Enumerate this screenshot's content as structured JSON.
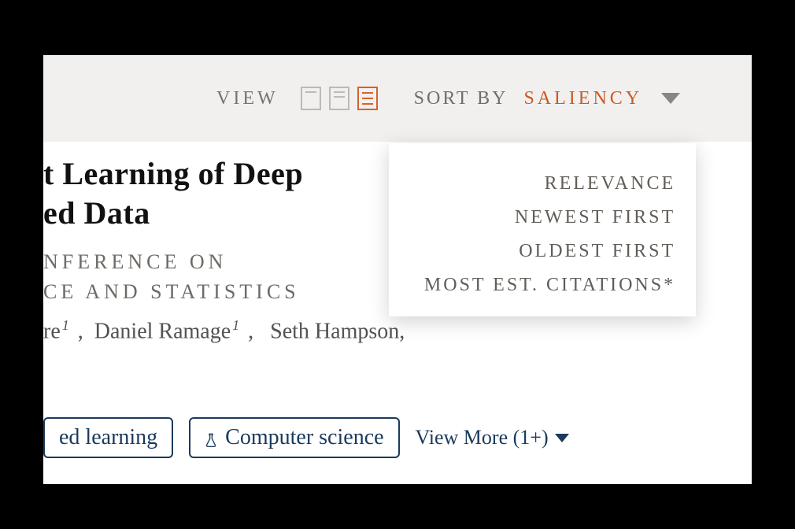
{
  "toolbar": {
    "view_label": "VIEW",
    "sort_label": "SORT BY",
    "sort_selected": "SALIENCY",
    "sort_options": [
      "RELEVANCE",
      "NEWEST FIRST",
      "OLDEST FIRST",
      "MOST EST. CITATIONS*"
    ]
  },
  "paper": {
    "title_line1": "t Learning of Deep",
    "title_line2": "ed Data",
    "venue_line1": "NFERENCE ON",
    "venue_line2": "CE AND STATISTICS",
    "authors_fragment": "re",
    "author2": "Daniel Ramage",
    "author3": "Seth Hampson,",
    "affil": "1"
  },
  "tags": {
    "tag1": "ed learning",
    "tag2": "Computer science",
    "view_more": "View More (1+)"
  }
}
